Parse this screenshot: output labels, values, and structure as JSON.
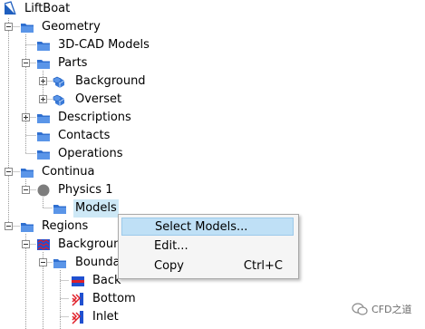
{
  "tree": {
    "root": "LiftBoat",
    "geometry": "Geometry",
    "cad_models": "3D-CAD Models",
    "parts": "Parts",
    "part_background": "Background",
    "part_overset": "Overset",
    "descriptions": "Descriptions",
    "contacts": "Contacts",
    "operations": "Operations",
    "continua": "Continua",
    "physics": "Physics 1",
    "models": "Models",
    "regions": "Regions",
    "region_background": "Backgroun",
    "boundaries": "Bounda",
    "boundary_back": "Back",
    "boundary_bottom": "Bottom",
    "boundary_inlet": "Inlet"
  },
  "context_menu": {
    "select_models": "Select Models...",
    "edit": "Edit...",
    "copy": "Copy",
    "copy_shortcut": "Ctrl+C"
  },
  "watermark": {
    "text": "CFD之道"
  },
  "colors": {
    "folder": "#2f6fd0",
    "selection": "#cde8f6",
    "menu_highlight": "#bfe0f6",
    "boundary_red": "#e0202a",
    "boundary_blue": "#2050d0"
  }
}
